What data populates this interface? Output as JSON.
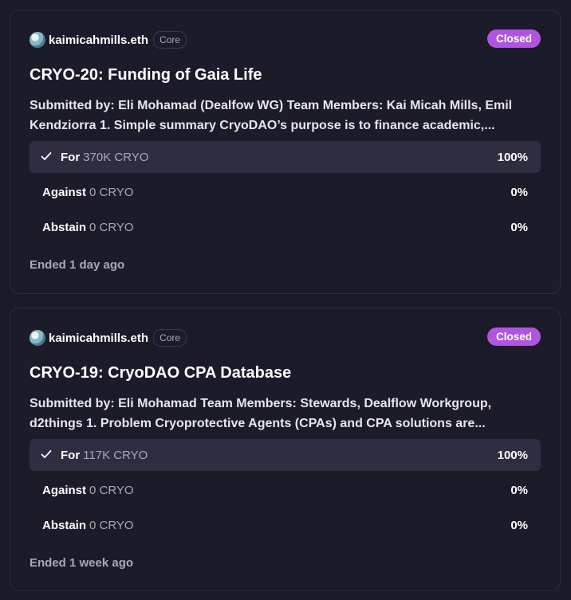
{
  "proposals": [
    {
      "author": "kaimicahmills.eth",
      "space_badge": "Core",
      "status": "Closed",
      "title": "CRYO-20: Funding of Gaia Life",
      "summary": "Submitted by: Eli Mohamad (Dealfow WG) Team Members: Kai Micah Mills, Emil Kendziorra 1. Simple summary CryoDAO’s purpose is to finance academic,...",
      "choices": [
        {
          "label": "For",
          "amount": "370K CRYO",
          "percent": "100%",
          "selected": true
        },
        {
          "label": "Against",
          "amount": "0 CRYO",
          "percent": "0%",
          "selected": false
        },
        {
          "label": "Abstain",
          "amount": "0 CRYO",
          "percent": "0%",
          "selected": false
        }
      ],
      "ended": "Ended 1 day ago"
    },
    {
      "author": "kaimicahmills.eth",
      "space_badge": "Core",
      "status": "Closed",
      "title": "CRYO-19: CryoDAO CPA Database",
      "summary": "Submitted by: Eli Mohamad Team Members: Stewards, Dealflow Workgroup, d2things 1. Problem Cryoprotective Agents (CPAs) and CPA solutions are...",
      "choices": [
        {
          "label": "For",
          "amount": "117K CRYO",
          "percent": "100%",
          "selected": true
        },
        {
          "label": "Against",
          "amount": "0 CRYO",
          "percent": "0%",
          "selected": false
        },
        {
          "label": "Abstain",
          "amount": "0 CRYO",
          "percent": "0%",
          "selected": false
        }
      ],
      "ended": "Ended 1 week ago"
    }
  ],
  "colors": {
    "background": "#1c1b29",
    "card_border": "#2e2d3d",
    "status_closed": "#b055e0",
    "selected_row": "#2f2d41",
    "muted_text": "#a9a8b5"
  },
  "icons": {
    "avatar": "avatar",
    "selected_choice": "checkmark-icon"
  }
}
